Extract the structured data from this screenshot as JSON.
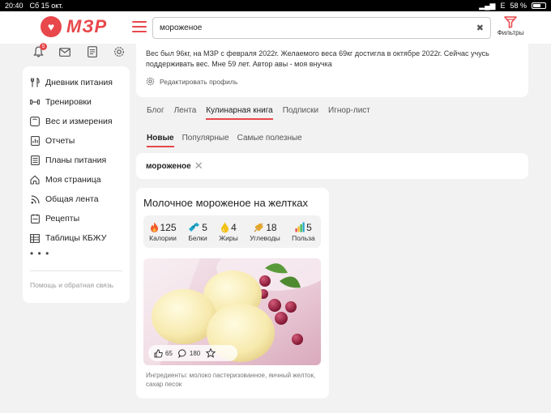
{
  "status_bar": {
    "time": "20:40",
    "date": "Сб 15 окт.",
    "network": "E",
    "battery": "58 %"
  },
  "header": {
    "logo_text": "МЗР",
    "search": {
      "value": "мороженое",
      "placeholder": ""
    },
    "filters_label": "Фильтры"
  },
  "top_icons": {
    "notifications_count": "5"
  },
  "sidebar": {
    "items": [
      {
        "label": "Дневник питания",
        "icon": "cutlery-icon"
      },
      {
        "label": "Тренировки",
        "icon": "dumbbell-icon"
      },
      {
        "label": "Вес и измерения",
        "icon": "scale-icon"
      },
      {
        "label": "Отчеты",
        "icon": "report-icon"
      },
      {
        "label": "Планы питания",
        "icon": "plan-icon"
      },
      {
        "label": "Моя страница",
        "icon": "home-icon"
      },
      {
        "label": "Общая лента",
        "icon": "rss-icon"
      },
      {
        "label": "Рецепты",
        "icon": "recipe-icon"
      },
      {
        "label": "Таблицы КБЖУ",
        "icon": "table-icon"
      }
    ],
    "more_label": "• • •",
    "help_label": "Помощь и обратная связь"
  },
  "profile": {
    "text": "Вес был 96кг, на МЗР с февраля 2022г. Желаемого веса 69кг достигла в октябре 2022г. Сейчас учусь поддерживать вес. Мне 59 лет. Автор авы - моя внучка",
    "edit_label": "Редактировать профиль"
  },
  "tabs": [
    "Блог",
    "Лента",
    "Кулинарная книга",
    "Подписки",
    "Игнор-лист"
  ],
  "active_tab": "Кулинарная книга",
  "subtabs": [
    "Новые",
    "Популярные",
    "Самые полезные"
  ],
  "active_subtab": "Новые",
  "filter_chip": "мороженое",
  "recipe": {
    "title": "Молочное мороженое на желтках",
    "nutrition": [
      {
        "value": "125",
        "label": "Калории",
        "icon": "flame-icon",
        "color": "#f05a28"
      },
      {
        "value": "5",
        "label": "Белки",
        "icon": "protein-icon",
        "color": "#1fa5c9"
      },
      {
        "value": "4",
        "label": "Жиры",
        "icon": "drop-icon",
        "color": "#f2c21b"
      },
      {
        "value": "18",
        "label": "Углеводы",
        "icon": "grain-icon",
        "color": "#e5a92b"
      },
      {
        "value": "5",
        "label": "Польза",
        "icon": "bars-icon",
        "color": "#3cb54a"
      }
    ],
    "likes": "65",
    "comments": "180",
    "ingredients": "Ингредиенты: молоко пастеризованное, яичный желток, сахар песок"
  },
  "colors": {
    "accent": "#e8474b",
    "background": "#f2f2f2"
  }
}
